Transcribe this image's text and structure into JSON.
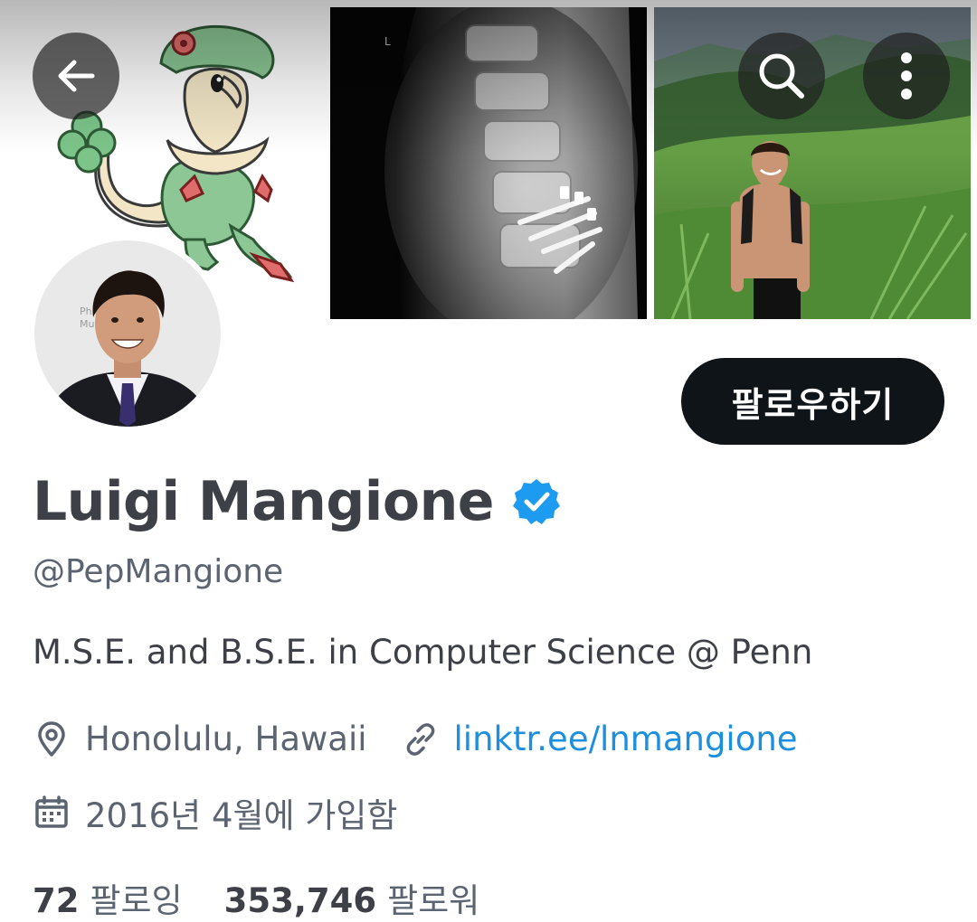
{
  "header": {
    "back_icon": "arrow-left-icon",
    "search_icon": "search-icon",
    "more_icon": "more-vertical-icon"
  },
  "profile": {
    "display_name": "Luigi Mangione",
    "verified": true,
    "handle": "@PepMangione",
    "bio": "M.S.E. and B.S.E. in Computer Science @ Penn",
    "location": "Honolulu, Hawaii",
    "website": "linktr.ee/lnmangione",
    "joined": "2016년 4월에 가입함",
    "follow_label": "팔로우하기"
  },
  "stats": {
    "following_count": "72",
    "following_label": "팔로잉",
    "followers_count": "353,746",
    "followers_label": "팔로워"
  },
  "colors": {
    "verified_blue": "#1d9bf0",
    "link_blue": "#1d8fe0",
    "follow_button_bg": "#0f1419",
    "text_dark": "#3d4046",
    "text_muted": "#5b6470"
  }
}
